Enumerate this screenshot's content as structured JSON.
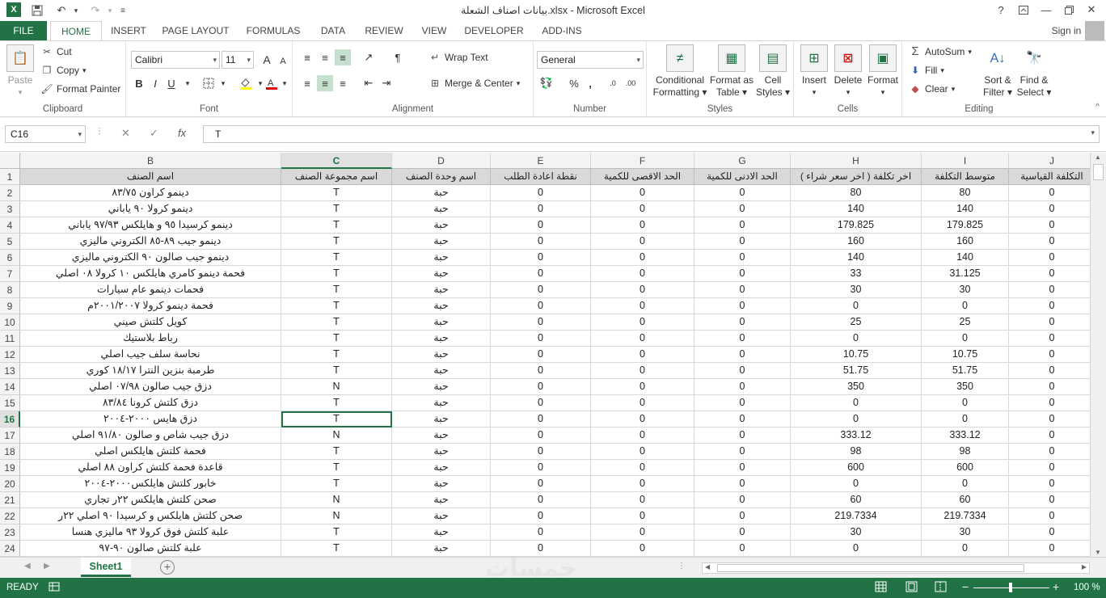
{
  "window": {
    "title": "بيانات اصناف الشعلة.xlsx - Microsoft Excel",
    "help": "?",
    "signin": "Sign in"
  },
  "tabs": [
    "FILE",
    "HOME",
    "INSERT",
    "PAGE LAYOUT",
    "FORMULAS",
    "DATA",
    "REVIEW",
    "VIEW",
    "DEVELOPER",
    "ADD-INS"
  ],
  "ribbon": {
    "clipboard": {
      "label": "Clipboard",
      "paste": "Paste",
      "cut": "Cut",
      "copy": "Copy",
      "format_painter": "Format Painter"
    },
    "font": {
      "label": "Font",
      "name": "Calibri",
      "size": "11",
      "bold": "B",
      "italic": "I",
      "underline": "U",
      "grow": "A",
      "shrink": "A"
    },
    "alignment": {
      "label": "Alignment",
      "wrap": "Wrap Text",
      "merge": "Merge & Center"
    },
    "number": {
      "label": "Number",
      "format": "General",
      "percent": "%",
      "comma": ","
    },
    "styles": {
      "label": "Styles",
      "conditional": "Conditional Formatting",
      "cond1": "Conditional",
      "cond2": "Formatting",
      "table1": "Format as",
      "table2": "Table",
      "cell1": "Cell",
      "cell2": "Styles"
    },
    "cells": {
      "label": "Cells",
      "insert": "Insert",
      "delete": "Delete",
      "format": "Format"
    },
    "editing": {
      "label": "Editing",
      "autosum": "AutoSum",
      "fill": "Fill",
      "clear": "Clear",
      "sort1": "Sort &",
      "sort2": "Filter",
      "find1": "Find &",
      "find2": "Select"
    }
  },
  "formula_bar": {
    "name_box": "C16",
    "value": "T",
    "fx": "fx"
  },
  "columns": [
    "B",
    "C",
    "D",
    "E",
    "F",
    "G",
    "H",
    "I",
    "J"
  ],
  "header_row": [
    "اسم الصنف",
    "اسم مجموعة الصنف",
    "اسم وحدة الصنف",
    "نقطة اعادة الطلب",
    "الحد الاقصى للكمية",
    "الحد الادنى للكمية",
    "اخر تكلفة ( اخر سعر شراء )",
    "متوسط التكلفة",
    "التكلفة القياسية"
  ],
  "rows": [
    {
      "n": "2",
      "c": [
        "دينمو كراون ٨٣/٧٥",
        "T",
        "حبة",
        "0",
        "0",
        "0",
        "80",
        "80",
        "0"
      ]
    },
    {
      "n": "3",
      "c": [
        "دينمو كرولا ٩٠ ياباني",
        "T",
        "حبة",
        "0",
        "0",
        "0",
        "140",
        "140",
        "0"
      ]
    },
    {
      "n": "4",
      "c": [
        "دينمو كرسيدا ٩٥ و هايلكس ٩٧/٩٣ ياباني",
        "T",
        "حبة",
        "0",
        "0",
        "0",
        "179.825",
        "179.825",
        "0"
      ]
    },
    {
      "n": "5",
      "c": [
        "دينمو جيب ٨٩-٨٥ الكتروني ماليزي",
        "T",
        "حبة",
        "0",
        "0",
        "0",
        "160",
        "160",
        "0"
      ]
    },
    {
      "n": "6",
      "c": [
        "دينمو جيب صالون ٩٠ الكتروني ماليزي",
        "T",
        "حبة",
        "0",
        "0",
        "0",
        "140",
        "140",
        "0"
      ]
    },
    {
      "n": "7",
      "c": [
        "فحمة دينمو كامري هايلكس ١٠ كرولا ٠٨ اصلي",
        "T",
        "حبة",
        "0",
        "0",
        "0",
        "33",
        "31.125",
        "0"
      ]
    },
    {
      "n": "8",
      "c": [
        "فحمات دينمو عام سيارات",
        "T",
        "حبة",
        "0",
        "0",
        "0",
        "30",
        "30",
        "0"
      ]
    },
    {
      "n": "9",
      "c": [
        "فحمة دينمو كرولا ٢٠٠١/٢٠٠٧م",
        "T",
        "حبة",
        "0",
        "0",
        "0",
        "0",
        "0",
        "0"
      ]
    },
    {
      "n": "10",
      "c": [
        "كويل كلتش صيني",
        "T",
        "حبة",
        "0",
        "0",
        "0",
        "25",
        "25",
        "0"
      ]
    },
    {
      "n": "11",
      "c": [
        "رباط بلاستيك",
        "T",
        "حبة",
        "0",
        "0",
        "0",
        "0",
        "0",
        "0"
      ]
    },
    {
      "n": "12",
      "c": [
        "نحاسة سلف جيب اصلي",
        "T",
        "حبة",
        "0",
        "0",
        "0",
        "10.75",
        "10.75",
        "0"
      ]
    },
    {
      "n": "13",
      "c": [
        "طرمبة بنزين النترا ١٨/١٧ كوري",
        "T",
        "حبة",
        "0",
        "0",
        "0",
        "51.75",
        "51.75",
        "0"
      ]
    },
    {
      "n": "14",
      "c": [
        "دزق جيب صالون ٠٧/٩٨ اصلي",
        "N",
        "حبة",
        "0",
        "0",
        "0",
        "350",
        "350",
        "0"
      ]
    },
    {
      "n": "15",
      "c": [
        "دزق كلتش كرونا ٨٣/٨٤",
        "T",
        "حبة",
        "0",
        "0",
        "0",
        "0",
        "0",
        "0"
      ]
    },
    {
      "n": "16",
      "c": [
        "دزق هايس ٢٠٠٠-٢٠٠٤",
        "T",
        "حبة",
        "0",
        "0",
        "0",
        "0",
        "0",
        "0"
      ]
    },
    {
      "n": "17",
      "c": [
        "دزق جيب شاص و صالون ٩١/٨٠ اصلي",
        "N",
        "حبة",
        "0",
        "0",
        "0",
        "333.12",
        "333.12",
        "0"
      ]
    },
    {
      "n": "18",
      "c": [
        "فحمة كلتش هايلكس اصلي",
        "T",
        "حبة",
        "0",
        "0",
        "0",
        "98",
        "98",
        "0"
      ]
    },
    {
      "n": "19",
      "c": [
        "قاعدة فحمة كلتش كراون ٨٨ اصلي",
        "T",
        "حبة",
        "0",
        "0",
        "0",
        "600",
        "600",
        "0"
      ]
    },
    {
      "n": "20",
      "c": [
        "خابور كلتش هايلكس٢٠٠٠-٢٠٠٤",
        "T",
        "حبة",
        "0",
        "0",
        "0",
        "0",
        "0",
        "0"
      ]
    },
    {
      "n": "21",
      "c": [
        "صحن كلتش هايلكس ٢٢ر تجاري",
        "N",
        "حبة",
        "0",
        "0",
        "0",
        "60",
        "60",
        "0"
      ]
    },
    {
      "n": "22",
      "c": [
        "صحن كلتش هايلكس و كرسيدا ٩٠ اصلي ٢٢ر",
        "N",
        "حبة",
        "0",
        "0",
        "0",
        "219.7334",
        "219.7334",
        "0"
      ]
    },
    {
      "n": "23",
      "c": [
        "علبة كلتش فوق كرولا ٩٣ ماليزي هنسا",
        "T",
        "حبة",
        "0",
        "0",
        "0",
        "30",
        "30",
        "0"
      ]
    },
    {
      "n": "24",
      "c": [
        "علبة كلتش صالون ٩٠-٩٧",
        "T",
        "حبة",
        "0",
        "0",
        "0",
        "0",
        "0",
        "0"
      ]
    }
  ],
  "active": {
    "col": "C",
    "row": "16"
  },
  "sheets": [
    "Sheet1"
  ],
  "watermark": "خمسات",
  "status": {
    "ready": "READY",
    "zoom": "100 %"
  }
}
